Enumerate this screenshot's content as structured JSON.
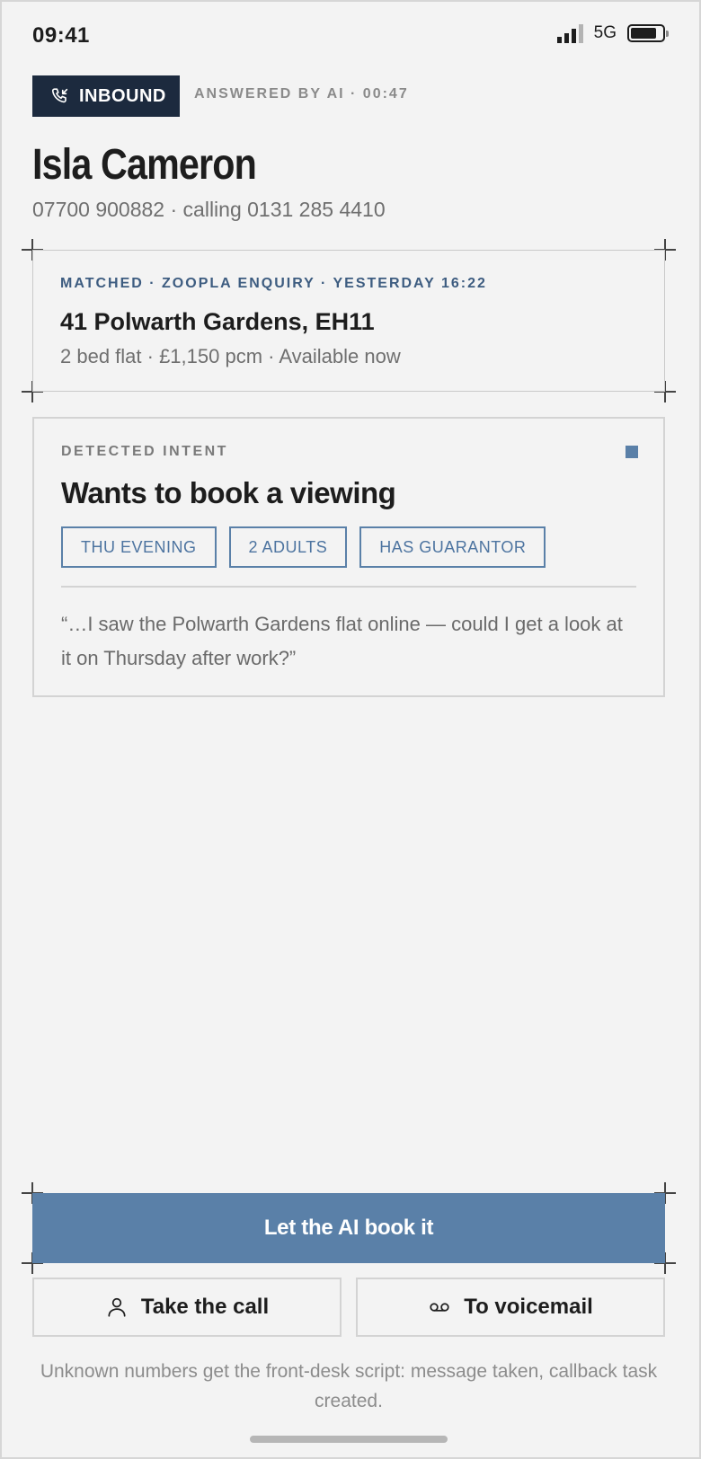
{
  "status_bar": {
    "time": "09:41",
    "network": "5G",
    "signal_level": 0.75,
    "battery_level": 0.85
  },
  "call": {
    "direction_label": "INBOUND",
    "direction_icon": "phone-incoming-icon",
    "answered_meta": "ANSWERED BY AI · 00:47",
    "caller_name": "Isla Cameron",
    "caller_sub": "07700 900882 · calling 0131 285 4410"
  },
  "match": {
    "label": "MATCHED · ZOOPLA ENQUIRY · YESTERDAY 16:22",
    "property": "41 Polwarth Gardens, EH11",
    "details": "2 bed flat · £1,150 pcm · Available now"
  },
  "intent": {
    "label": "DETECTED INTENT",
    "title": "Wants to book a viewing",
    "tags": [
      "THU EVENING",
      "2 ADULTS",
      "HAS GUARANTOR"
    ],
    "quote": "“…I saw the Polwarth Gardens flat online — could I get a look at it on Thursday after work?”",
    "accent_color": "#5a80a8"
  },
  "actions": {
    "primary_label": "Let the AI book it",
    "take_call_label": "Take the call",
    "take_call_icon": "person-icon",
    "voicemail_label": "To voicemail",
    "voicemail_icon": "voicemail-icon",
    "footnote": "Unknown numbers get the front-desk script: message taken, callback task created."
  },
  "colors": {
    "primary": "#5a80a8",
    "dark_badge": "#1c2a3e",
    "background": "#f3f3f3"
  }
}
